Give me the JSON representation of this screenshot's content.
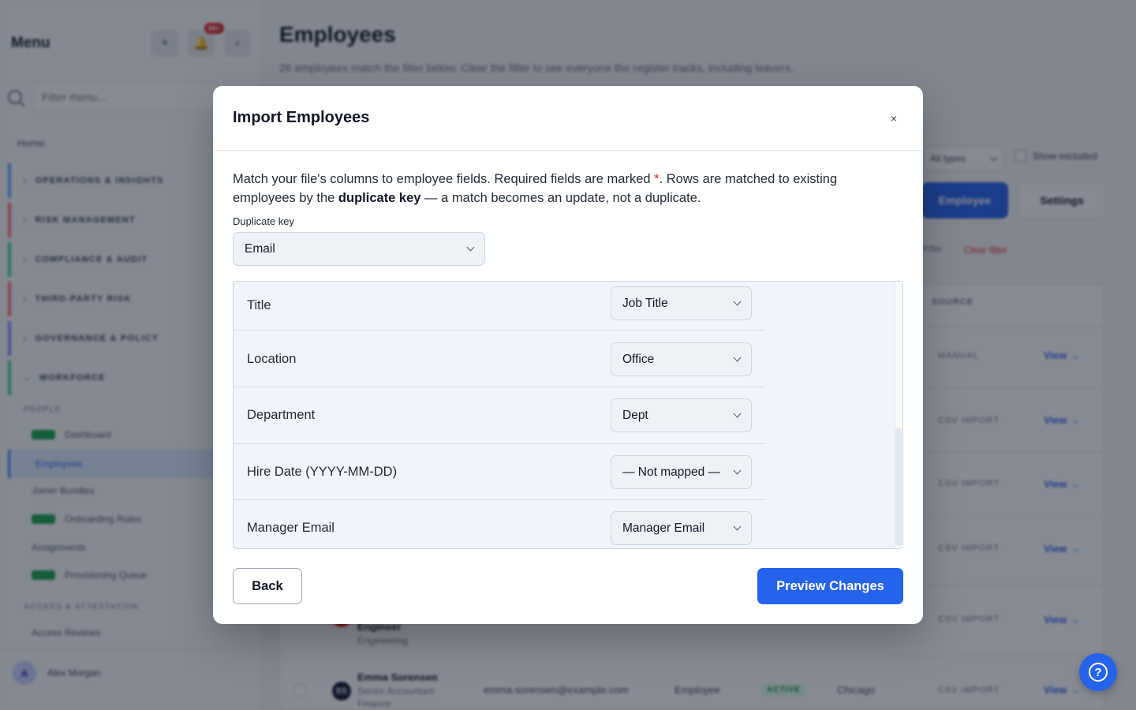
{
  "sidebar": {
    "title": "Menu",
    "badge_count": "99+",
    "filter_placeholder": "Filter menu...",
    "home_label": "Home",
    "groups": [
      {
        "label": "OPERATIONS & INSIGHTS",
        "color": "#60a5fa"
      },
      {
        "label": "RISK MANAGEMENT",
        "color": "#f87171"
      },
      {
        "label": "COMPLIANCE & AUDIT",
        "color": "#34d399"
      },
      {
        "label": "THIRD-PARTY RISK",
        "color": "#f87171"
      },
      {
        "label": "GOVERNANCE & POLICY",
        "color": "#818cf8"
      },
      {
        "label": "WORKFORCE",
        "color": "#34d399"
      }
    ],
    "people_label": "PEOPLE",
    "items": [
      {
        "label": "Dashboard"
      },
      {
        "label": "Employees"
      },
      {
        "label": "Joiner Bundles"
      },
      {
        "label": "Onboarding Rules"
      },
      {
        "label": "Assignments"
      },
      {
        "label": "Provisioning Queue"
      }
    ],
    "access_label": "ACCESS & ATTESTATION",
    "access_item": "Access Reviews",
    "user_initial": "A",
    "user_name": "Alex Morgan"
  },
  "main": {
    "title": "Employees",
    "subtitle": "26 employees match the filter below. Clear the filter to see everyone the register tracks, including leavers.",
    "type_select": "All types",
    "show_excluded": "Show excluded",
    "add_button": "Employee",
    "settings_button": "Settings",
    "filter_label": "Filter",
    "clear_filter": "Clear filter",
    "source_header": "SOURCE",
    "rows": [
      {
        "source": "MANUAL",
        "view": "View →"
      },
      {
        "source": "CSV IMPORT",
        "view": "View →"
      },
      {
        "source": "CSV IMPORT",
        "view": "View →"
      },
      {
        "source": "CSV IMPORT",
        "view": "View →"
      },
      {
        "source": "CSV IMPORT",
        "view": "View →"
      },
      {
        "source": "CSV IMPORT",
        "view": "View →"
      }
    ],
    "row5_name": "Engineer",
    "row5_dept": "Engineering",
    "row6": {
      "initials": "ES",
      "name": "Emma Sorensen",
      "role": "Senior Accountant",
      "dept": "Finance",
      "email": "emma.sorensen@example.com",
      "type": "Employee",
      "status": "ACTIVE",
      "location": "Chicago"
    }
  },
  "modal": {
    "title": "Import Employees",
    "close_glyph": "×",
    "intro_part1": "Match your file's columns to employee fields. Required fields are marked ",
    "intro_required_mark": "*",
    "intro_part2": ". Rows are matched to existing employees by the ",
    "intro_bold": "duplicate key",
    "intro_part3": " — a match becomes an update, not a duplicate.",
    "duplicate_key_label": "Duplicate key",
    "duplicate_key_value": "Email",
    "mappings": [
      {
        "field": "Title",
        "mapped": "Job Title"
      },
      {
        "field": "Location",
        "mapped": "Office"
      },
      {
        "field": "Department",
        "mapped": "Dept"
      },
      {
        "field": "Hire Date (YYYY-MM-DD)",
        "mapped": "— Not mapped —"
      },
      {
        "field": "Manager Email",
        "mapped": "Manager Email"
      }
    ],
    "back_label": "Back",
    "preview_label": "Preview Changes"
  },
  "help_icon": "question-circle-icon",
  "colors": {
    "primary": "#2563eb",
    "required": "#dc2626",
    "overlay": "rgba(17,24,39,0.5)"
  }
}
